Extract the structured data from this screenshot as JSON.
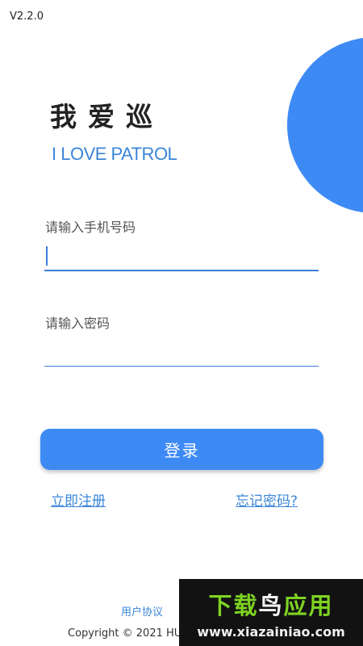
{
  "header": {
    "version": "V2.2.0"
  },
  "brand": {
    "title_cn": "我爱巡",
    "title_en": "I LOVE PATROL"
  },
  "form": {
    "phone_label": "请输入手机号码",
    "phone_value": "",
    "password_label": "请输入密码",
    "password_value": "",
    "login_label": "登录"
  },
  "links": {
    "register": "立即注册",
    "forgot": "忘记密码?"
  },
  "footer": {
    "agreement": "用户协议",
    "copyright": "Copyright © 2021 HU"
  },
  "watermark": {
    "title_part1": "下载",
    "title_part2": "鸟",
    "title_part3": "应用",
    "url": "www.xiazainiao.com"
  },
  "colors": {
    "accent": "#3e8af5",
    "link": "#3b86d8",
    "underline": "#3d7fd8"
  }
}
